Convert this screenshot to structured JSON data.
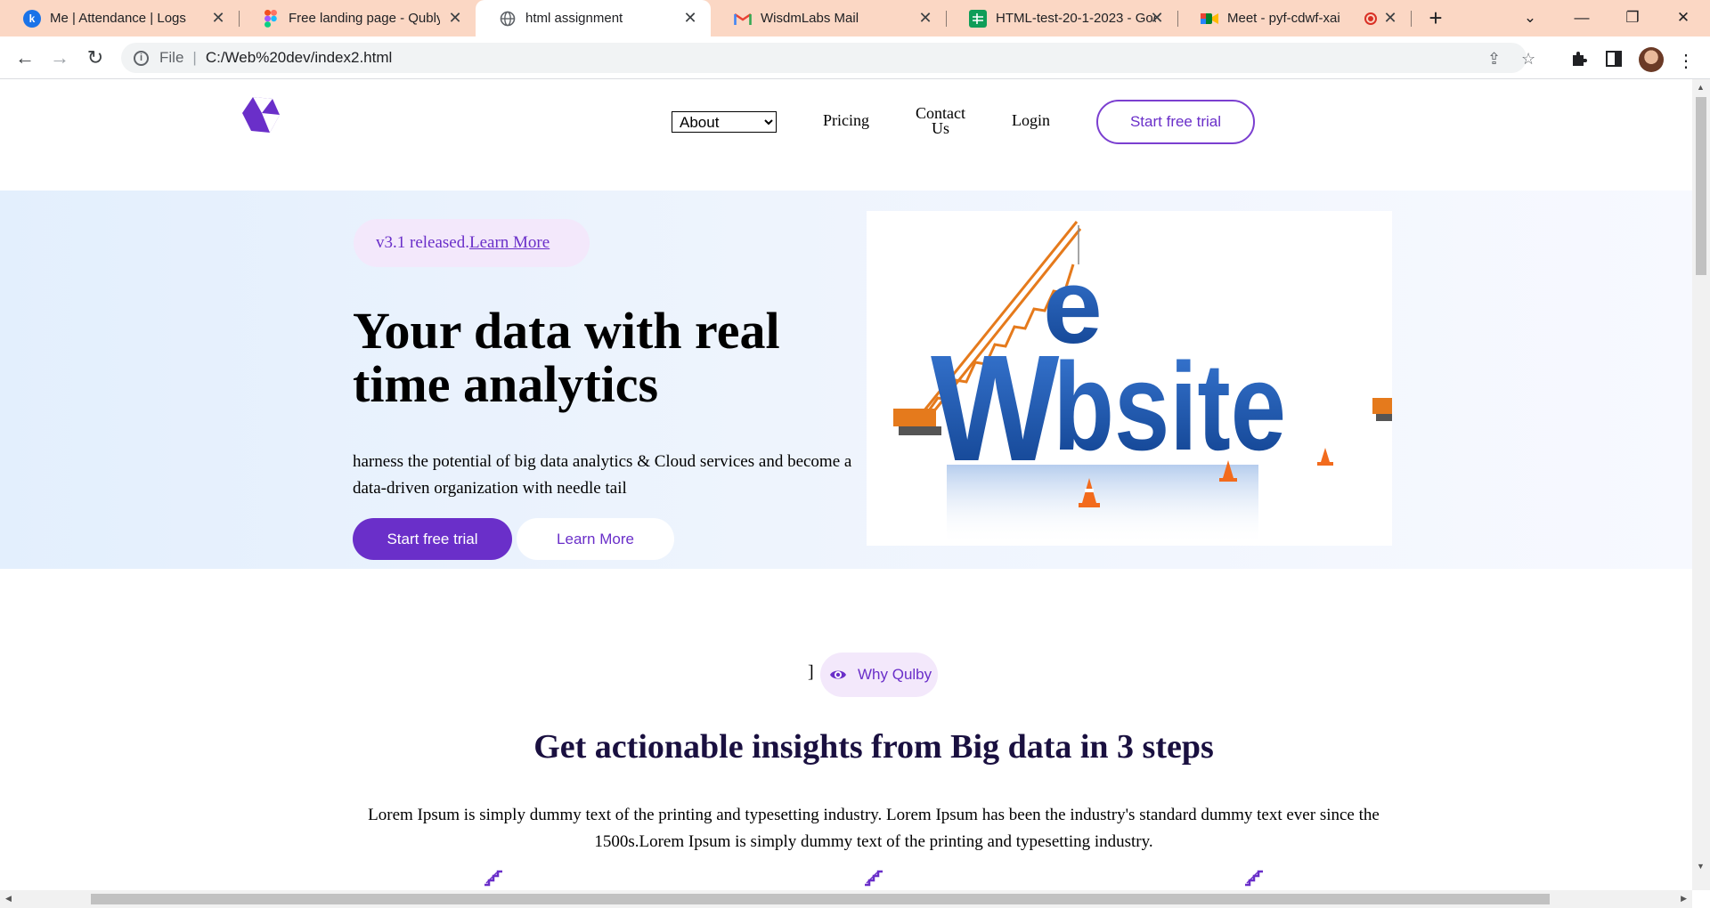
{
  "browser": {
    "tabs": [
      {
        "title": "Me | Attendance | Logs",
        "favicon": "k",
        "favicon_color": "#1a73e8"
      },
      {
        "title": "Free landing page - Qubly (",
        "favicon": "figma-icon"
      },
      {
        "title": "html assignment",
        "favicon": "globe-icon",
        "active": true
      },
      {
        "title": "WisdmLabs Mail",
        "favicon": "gmail-icon"
      },
      {
        "title": "HTML-test-20-1-2023 - Goo",
        "favicon": "sheets-icon"
      },
      {
        "title": "Meet - pyf-cdwf-xai",
        "favicon": "meet-icon",
        "recording": true
      }
    ],
    "address": {
      "scheme_label": "File",
      "url": "C:/Web%20dev/index2.html"
    }
  },
  "page": {
    "nav": {
      "about_select": {
        "selected": "About",
        "options": [
          "About"
        ]
      },
      "pricing": "Pricing",
      "contact_line1": "Contact",
      "contact_line2": "Us",
      "login": "Login",
      "trial_button": "Start free trial"
    },
    "hero": {
      "release_text": "v3.1 released.",
      "release_link": "Learn More",
      "title": "Your data with real time analytics",
      "subtitle": "harness the potential of big data analytics & Cloud services and become a data-driven organization with needle tail",
      "primary_button": "Start free trial",
      "secondary_button": "Learn More",
      "image_letters": "Website"
    },
    "why": {
      "bracket": "]",
      "pill_label": "Why Qulby",
      "title": "Get actionable insights from Big data in 3 steps",
      "description": "Lorem Ipsum is simply dummy text of the printing and typesetting industry. Lorem Ipsum has been the industry's standard dummy text ever since the 1500s.Lorem Ipsum is simply dummy text of the printing and typesetting industry."
    }
  },
  "colors": {
    "accent": "#6a2fc9",
    "tabstrip": "#fbd7c4",
    "hero_bg": "#e3effd",
    "pill_bg": "#f3e8fb"
  }
}
